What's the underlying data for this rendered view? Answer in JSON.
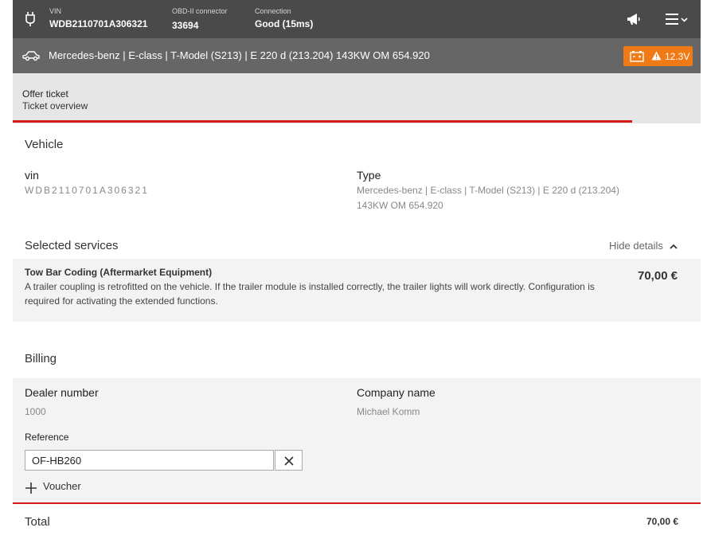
{
  "header": {
    "vin_label": "VIN",
    "vin_value": "WDB2110701A306321",
    "obd_label": "OBD-II connector",
    "obd_value": "33694",
    "connection_label": "Connection",
    "connection_value": "Good (15ms)",
    "icons": [
      "obd-plug-icon",
      "megaphone-icon",
      "hamburger-menu-icon",
      "chevron-down-icon"
    ]
  },
  "vehicle_bar": {
    "description": "Mercedes-benz | E-class | T-Model (S213) | E 220 d (213.204) 143KW OM 654.920",
    "battery_voltage": "12.3V",
    "badge_color": "#f07a16",
    "icons": [
      "car-icon",
      "battery-icon",
      "warning-icon"
    ]
  },
  "breadcrumb": {
    "title": "Offer ticket",
    "subtitle": "Ticket overview",
    "progress_color": "#d2191c"
  },
  "vehicle": {
    "section_title": "Vehicle",
    "vin_label": "vin",
    "vin_value": "WDB2110701A306321",
    "type_label": "Type",
    "type_line1": "Mercedes-benz | E-class | T-Model (S213) | E 220 d (213.204)",
    "type_line2": "143KW OM 654.920"
  },
  "services": {
    "section_title": "Selected services",
    "toggle_label": "Hide details",
    "items": [
      {
        "name": "Tow Bar Coding (Aftermarket Equipment)",
        "description": "A trailer coupling is retrofitted on the vehicle. If the trailer module is installed correctly, the trailer lights will work directly. Configuration is required for activating the extended functions.",
        "price": "70,00 €"
      }
    ]
  },
  "billing": {
    "section_title": "Billing",
    "dealer_label": "Dealer number",
    "dealer_value": "1000",
    "company_label": "Company name",
    "company_value": "Michael Komm",
    "reference_label": "Reference",
    "reference_value": "OF-HB260",
    "voucher_label": "Voucher"
  },
  "total": {
    "label": "Total",
    "value": "70,00 €"
  }
}
